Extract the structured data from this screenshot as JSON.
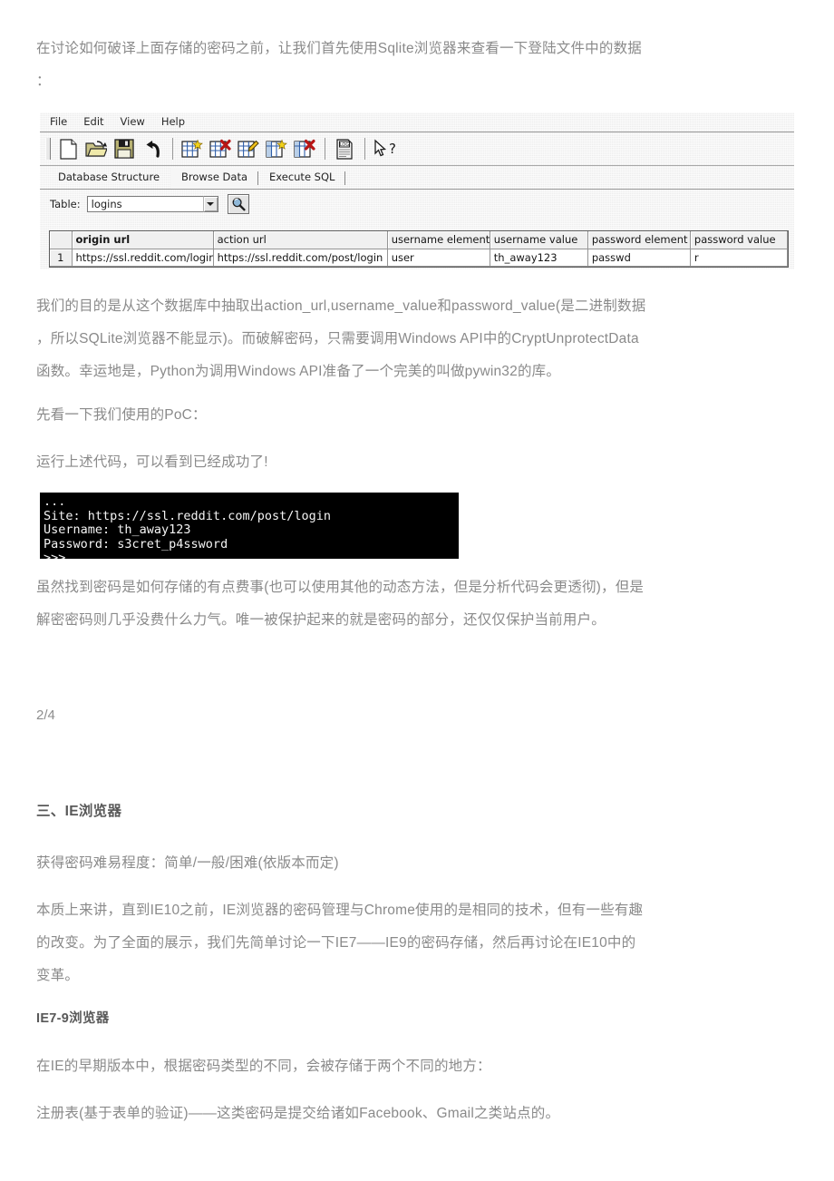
{
  "document": {
    "intro_paragraph": "在讨论如何破译上面存储的密码之前，让我们首先使用Sqlite浏览器来查看一下登陆文件中的数据\n：",
    "paragraph_extract": "我们的目的是从这个数据库中抽取出action_url,username_value和password_value(是二进制数据\n，所以SQLite浏览器不能显示)。而破解密码，只需要调用Windows API中的CryptUnprotectData\n函数。幸运地是，Python为调用Windows API准备了一个完美的叫做pywin32的库。",
    "poc_intro": "先看一下我们使用的PoC：",
    "run_result": "运行上述代码，可以看到已经成功了!",
    "conclusion_paragraph": "虽然找到密码是如何存储的有点费事(也可以使用其他的动态方法，但是分析代码会更透彻)，但是\n解密密码则几乎没费什么力气。唯一被保护起来的就是密码的部分，还仅仅保护当前用户。",
    "page_number": "2/4",
    "section_heading": "三、IE浏览器",
    "difficulty_line": "获得密码难易程度：简单/一般/困难(依版本而定)",
    "ie_paragraph": "本质上来讲，直到IE10之前，IE浏览器的密码管理与Chrome使用的是相同的技术，但有一些有趣\n的改变。为了全面的展示，我们先简单讨论一下IE7——IE9的密码存储，然后再讨论在IE10中的\n变革。",
    "ie79_heading": "IE7-9浏览器",
    "ie79_paragraph": "在IE的早期版本中，根据密码类型的不同，会被存储于两个不同的地方：",
    "registry_paragraph": "注册表(基于表单的验证)——这类密码是提交给诸如Facebook、Gmail之类站点的。"
  },
  "sqlite_browser": {
    "menu": [
      {
        "label": "File",
        "name": "menu-file"
      },
      {
        "label": "Edit",
        "name": "menu-edit"
      },
      {
        "label": "View",
        "name": "menu-view"
      },
      {
        "label": "Help",
        "name": "menu-help"
      }
    ],
    "toolbar_icons": [
      "new-database-icon",
      "open-database-icon",
      "save-database-icon",
      "revert-changes-icon",
      "create-table-icon",
      "delete-table-icon",
      "modify-table-icon",
      "create-index-icon",
      "delete-index-icon",
      "log-icon",
      "help-cursor-icon"
    ],
    "tabs": [
      {
        "label": "Database Structure",
        "selected": false
      },
      {
        "label": "Browse Data",
        "selected": true
      },
      {
        "label": "Execute SQL",
        "selected": false
      }
    ],
    "table_selector": {
      "label": "Table:",
      "value": "logins",
      "placeholder": "logins"
    },
    "search_icon": "magnifier-icon",
    "grid": {
      "columns": [
        "origin_url",
        "action_url",
        "username_element",
        "username_value",
        "password_element",
        "password_value"
      ],
      "column_display": [
        "origin  url",
        "action  url",
        "username  element",
        "username  value",
        "password  element",
        "password  value"
      ],
      "rows": [
        {
          "index": "1",
          "cells": [
            "https://ssl.reddit.com/login",
            "https://ssl.reddit.com/post/login",
            "user",
            "th_away123",
            "passwd",
            "r"
          ]
        }
      ]
    }
  },
  "console": {
    "lines": [
      "...",
      "Site: https://ssl.reddit.com/post/login",
      "Username: th_away123",
      "Password: s3cret_p4ssword",
      ">>>"
    ]
  },
  "colors": {
    "body_text": "#8a8a8a",
    "heading_text": "#595959",
    "window_bg": "#f2f2f2",
    "console_bg": "#000000",
    "console_fg": "#f4f4f4",
    "grid_border": "#5c5c5c"
  }
}
